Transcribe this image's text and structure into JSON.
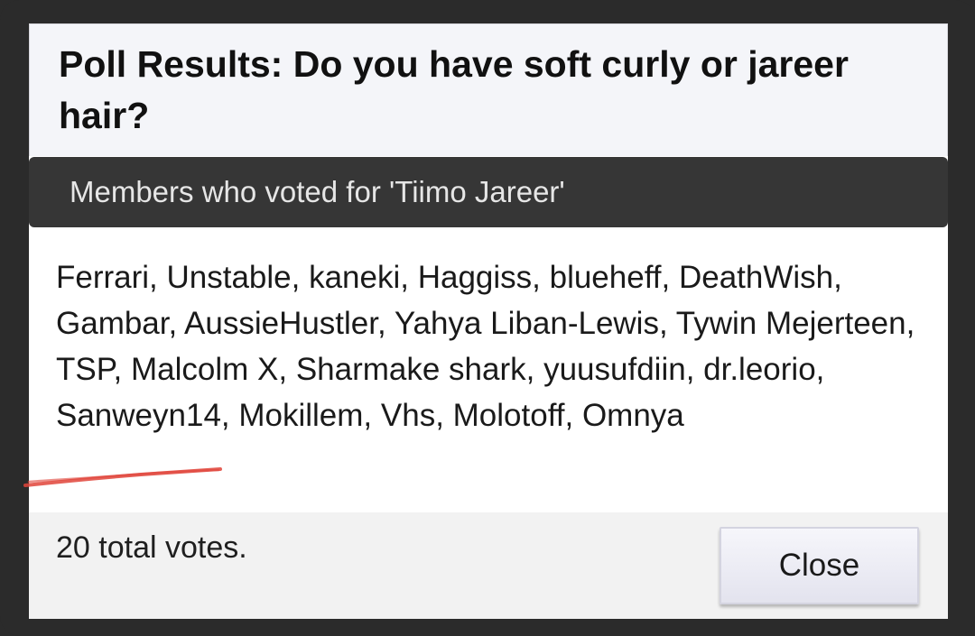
{
  "dialog": {
    "title": "Poll Results: Do you have soft curly or jareer hair?",
    "subheader": "Members who voted for 'Tiimo Jareer'",
    "voters_text": "Ferrari, Unstable, kaneki, Haggiss, blueheff, DeathWish, Gambar, AussieHustler, Yahya Liban-Lewis, Tywin Mejerteen, TSP, Malcolm X, Sharmake shark, yuusufdiin, dr.leorio, Sanweyn14, Mokillem, Vhs, Molotoff, Omnya",
    "total_votes": "20 total votes.",
    "close_label": "Close"
  },
  "annotation": {
    "color": "#e0443a"
  }
}
